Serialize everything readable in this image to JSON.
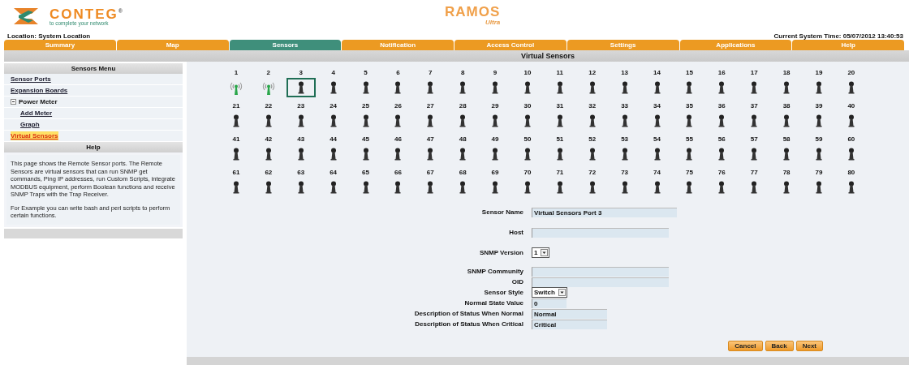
{
  "brand": {
    "name": "CONTEG",
    "mark": "®",
    "tagline": "to complete your network"
  },
  "product": {
    "name": "RAMOS",
    "edition": "Ultra"
  },
  "location": "Location: System Location",
  "system_time": "Current System Time: 05/07/2012 13:40:53",
  "tabs": [
    {
      "label": "Summary",
      "selected": false
    },
    {
      "label": "Map",
      "selected": false
    },
    {
      "label": "Sensors",
      "selected": true
    },
    {
      "label": "Notification",
      "selected": false
    },
    {
      "label": "Access Control",
      "selected": false
    },
    {
      "label": "Settings",
      "selected": false
    },
    {
      "label": "Applications",
      "selected": false
    },
    {
      "label": "Help",
      "selected": false
    }
  ],
  "page_title": "Virtual Sensors",
  "sidebar": {
    "title": "Sensors Menu",
    "items": [
      {
        "label": "Sensor Ports",
        "selected": false
      },
      {
        "label": "Expansion Boards",
        "selected": false
      },
      {
        "label": "Power Meter",
        "expanded": true,
        "selected": false,
        "children": [
          {
            "label": "Add Meter",
            "selected": false
          },
          {
            "label": "Graph",
            "selected": false
          }
        ]
      },
      {
        "label": "Virtual Sensors",
        "selected": true
      }
    ],
    "help_title": "Help",
    "help_paragraphs": [
      "This page shows the Remote Sensor ports. The Remote Sensors are virtual sensors that can run SNMP get commands, Ping IP addresses, run Custom Scripts, integrate MODBUS equipment, perform Boolean functions and receive SNMP Traps with the Trap Receiver.",
      "For Example you can write bash and perl scripts to perform certain functions."
    ]
  },
  "sensors": [
    {
      "label": "1",
      "active": true,
      "selected": false
    },
    {
      "label": "2",
      "active": true,
      "selected": false
    },
    {
      "label": "3",
      "active": false,
      "selected": true
    },
    {
      "label": "4",
      "active": false,
      "selected": false
    },
    {
      "label": "5",
      "active": false,
      "selected": false
    },
    {
      "label": "6",
      "active": false,
      "selected": false
    },
    {
      "label": "7",
      "active": false,
      "selected": false
    },
    {
      "label": "8",
      "active": false,
      "selected": false
    },
    {
      "label": "9",
      "active": false,
      "selected": false
    },
    {
      "label": "10",
      "active": false,
      "selected": false
    },
    {
      "label": "11",
      "active": false,
      "selected": false
    },
    {
      "label": "12",
      "active": false,
      "selected": false
    },
    {
      "label": "13",
      "active": false,
      "selected": false
    },
    {
      "label": "14",
      "active": false,
      "selected": false
    },
    {
      "label": "15",
      "active": false,
      "selected": false
    },
    {
      "label": "16",
      "active": false,
      "selected": false
    },
    {
      "label": "17",
      "active": false,
      "selected": false
    },
    {
      "label": "18",
      "active": false,
      "selected": false
    },
    {
      "label": "19",
      "active": false,
      "selected": false
    },
    {
      "label": "20",
      "active": false,
      "selected": false
    },
    {
      "label": "21",
      "active": false,
      "selected": false
    },
    {
      "label": "22",
      "active": false,
      "selected": false
    },
    {
      "label": "23",
      "active": false,
      "selected": false
    },
    {
      "label": "24",
      "active": false,
      "selected": false
    },
    {
      "label": "25",
      "active": false,
      "selected": false
    },
    {
      "label": "26",
      "active": false,
      "selected": false
    },
    {
      "label": "27",
      "active": false,
      "selected": false
    },
    {
      "label": "28",
      "active": false,
      "selected": false
    },
    {
      "label": "29",
      "active": false,
      "selected": false
    },
    {
      "label": "30",
      "active": false,
      "selected": false
    },
    {
      "label": "31",
      "active": false,
      "selected": false
    },
    {
      "label": "32",
      "active": false,
      "selected": false
    },
    {
      "label": "33",
      "active": false,
      "selected": false
    },
    {
      "label": "34",
      "active": false,
      "selected": false
    },
    {
      "label": "35",
      "active": false,
      "selected": false
    },
    {
      "label": "36",
      "active": false,
      "selected": false
    },
    {
      "label": "37",
      "active": false,
      "selected": false
    },
    {
      "label": "38",
      "active": false,
      "selected": false
    },
    {
      "label": "39",
      "active": false,
      "selected": false
    },
    {
      "label": "40",
      "active": false,
      "selected": false
    },
    {
      "label": "41",
      "active": false,
      "selected": false
    },
    {
      "label": "42",
      "active": false,
      "selected": false
    },
    {
      "label": "43",
      "active": false,
      "selected": false
    },
    {
      "label": "44",
      "active": false,
      "selected": false
    },
    {
      "label": "45",
      "active": false,
      "selected": false
    },
    {
      "label": "46",
      "active": false,
      "selected": false
    },
    {
      "label": "47",
      "active": false,
      "selected": false
    },
    {
      "label": "48",
      "active": false,
      "selected": false
    },
    {
      "label": "49",
      "active": false,
      "selected": false
    },
    {
      "label": "50",
      "active": false,
      "selected": false
    },
    {
      "label": "51",
      "active": false,
      "selected": false
    },
    {
      "label": "52",
      "active": false,
      "selected": false
    },
    {
      "label": "53",
      "active": false,
      "selected": false
    },
    {
      "label": "54",
      "active": false,
      "selected": false
    },
    {
      "label": "55",
      "active": false,
      "selected": false
    },
    {
      "label": "56",
      "active": false,
      "selected": false
    },
    {
      "label": "57",
      "active": false,
      "selected": false
    },
    {
      "label": "58",
      "active": false,
      "selected": false
    },
    {
      "label": "59",
      "active": false,
      "selected": false
    },
    {
      "label": "60",
      "active": false,
      "selected": false
    },
    {
      "label": "61",
      "active": false,
      "selected": false
    },
    {
      "label": "62",
      "active": false,
      "selected": false
    },
    {
      "label": "63",
      "active": false,
      "selected": false
    },
    {
      "label": "64",
      "active": false,
      "selected": false
    },
    {
      "label": "65",
      "active": false,
      "selected": false
    },
    {
      "label": "66",
      "active": false,
      "selected": false
    },
    {
      "label": "67",
      "active": false,
      "selected": false
    },
    {
      "label": "68",
      "active": false,
      "selected": false
    },
    {
      "label": "69",
      "active": false,
      "selected": false
    },
    {
      "label": "70",
      "active": false,
      "selected": false
    },
    {
      "label": "71",
      "active": false,
      "selected": false
    },
    {
      "label": "72",
      "active": false,
      "selected": false
    },
    {
      "label": "73",
      "active": false,
      "selected": false
    },
    {
      "label": "74",
      "active": false,
      "selected": false
    },
    {
      "label": "75",
      "active": false,
      "selected": false
    },
    {
      "label": "76",
      "active": false,
      "selected": false
    },
    {
      "label": "77",
      "active": false,
      "selected": false
    },
    {
      "label": "78",
      "active": false,
      "selected": false
    },
    {
      "label": "79",
      "active": false,
      "selected": false
    },
    {
      "label": "80",
      "active": false,
      "selected": false
    }
  ],
  "form": [
    {
      "label": "Sensor Name",
      "kind": "text",
      "value": "Virtual Sensors Port 3"
    },
    {
      "label": "Host",
      "kind": "text"
    },
    {
      "label": "SNMP Version",
      "kind": "select",
      "value": "1"
    },
    {
      "label": "SNMP Community",
      "kind": "text"
    },
    {
      "label": "OID",
      "kind": "text"
    },
    {
      "label": "Sensor Style",
      "kind": "select",
      "value": "Switch"
    },
    {
      "label": "Normal State Value",
      "kind": "text",
      "value": "0"
    },
    {
      "label": "Description of Status When Normal",
      "kind": "text",
      "value": "Normal"
    },
    {
      "label": "Description of Status When Critical",
      "kind": "text",
      "value": "Critical"
    }
  ],
  "buttons": [
    "Cancel",
    "Back",
    "Next"
  ]
}
